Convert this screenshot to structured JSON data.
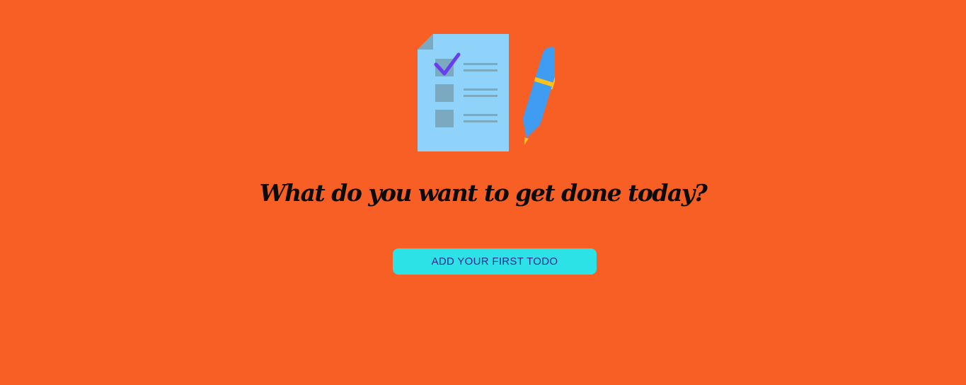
{
  "hero": {
    "illustration_icon": "checklist-with-pen-icon",
    "headline": "What do you want to get done today?"
  },
  "actions": {
    "add_first_todo_label": "ADD YOUR FIRST TODO"
  },
  "colors": {
    "background": "#f75f25",
    "button_bg": "#2de2e6",
    "button_text": "#2b2a8c",
    "headline_text": "#0b0b0b"
  }
}
